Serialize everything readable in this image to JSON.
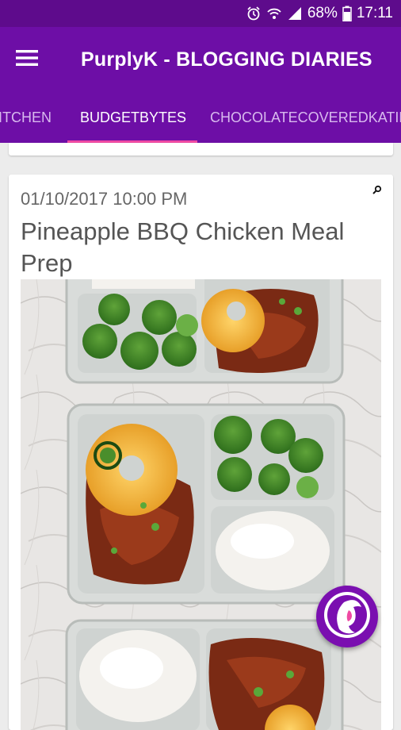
{
  "status_bar": {
    "battery": "68%",
    "time": "17:11",
    "icons": [
      "alarm-icon",
      "wifi-icon",
      "signal-icon",
      "battery-icon"
    ]
  },
  "app_bar": {
    "title": "PurplyK - BLOGGING DIARIES",
    "menu_icon": "hamburger-menu-icon"
  },
  "tabs": [
    {
      "label": "ITCHEN",
      "active": false
    },
    {
      "label": "BUDGETBYTES",
      "active": true
    },
    {
      "label": "CHOCOLATECOVEREDKATIE",
      "active": false
    }
  ],
  "post": {
    "date": "01/10/2017 10:00 PM",
    "title": "Pineapple BBQ Chicken Meal Prep",
    "image_icon": "meal-prep-photo",
    "zoom_icon": "zoom-icon"
  },
  "fab": {
    "icon": "woman-profile-icon"
  },
  "colors": {
    "status_bar": "#5e0b8c",
    "app_bar": "#6d0ea6",
    "tab_indicator": "#ef4aa3",
    "fab": "#7a0fb0"
  }
}
